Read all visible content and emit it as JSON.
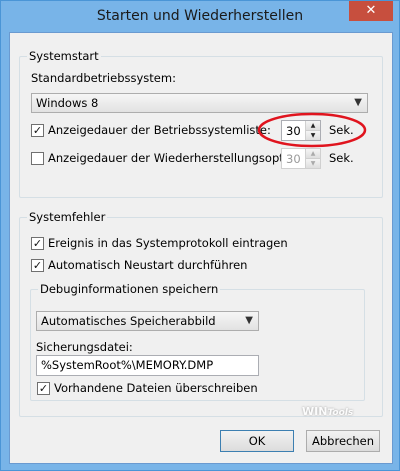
{
  "window": {
    "title": "Starten und Wiederherstellen",
    "close_glyph": "✕"
  },
  "systemstart": {
    "group_title": "Systemstart",
    "default_os_label": "Standardbetriebssystem:",
    "default_os_value": "Windows 8",
    "os_list": {
      "label": "Anzeigedauer der Betriebssystemliste:",
      "checked": true,
      "value": "30",
      "unit": "Sek."
    },
    "recovery": {
      "label": "Anzeigedauer der Wiederherstellungsoptionen:",
      "checked": false,
      "value": "30",
      "unit": "Sek."
    }
  },
  "systemfehler": {
    "group_title": "Systemfehler",
    "log_event": {
      "label": "Ereignis in das Systemprotokoll eintragen",
      "checked": true
    },
    "auto_restart": {
      "label": "Automatisch Neustart durchführen",
      "checked": true
    },
    "debug": {
      "group_title": "Debuginformationen speichern",
      "dump_type": "Automatisches Speicherabbild",
      "dump_file_label": "Sicherungsdatei:",
      "dump_file_value": "%SystemRoot%\\MEMORY.DMP",
      "overwrite": {
        "label": "Vorhandene Dateien überschreiben",
        "checked": true
      }
    }
  },
  "buttons": {
    "ok": "OK",
    "cancel": "Abbrechen"
  },
  "watermark": {
    "text_a": "WIN",
    "text_b": "Tools"
  },
  "colors": {
    "highlight_ring": "#e0141e",
    "title_bar": "#78b4e8",
    "close_button": "#c74f3e"
  }
}
